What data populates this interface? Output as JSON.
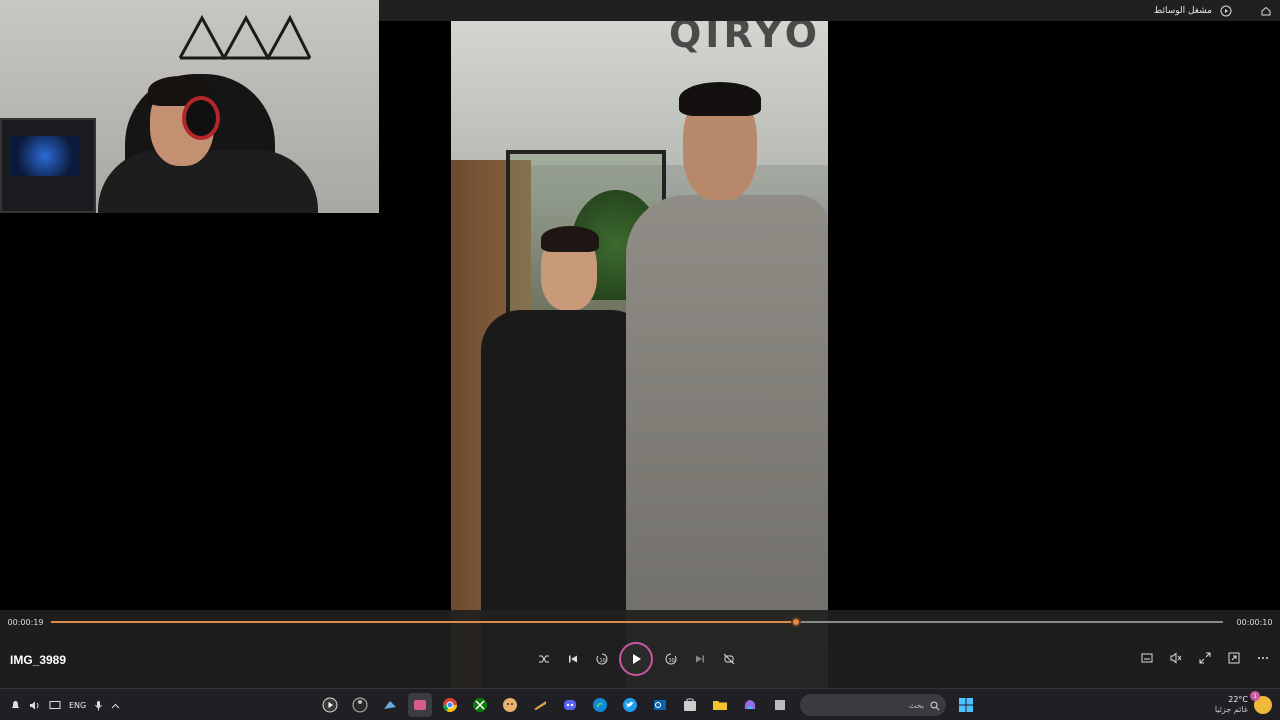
{
  "titlebar": {
    "app_title": "مشغل الوسائط",
    "app_icon": "play-circle-icon",
    "home_icon": "home-icon"
  },
  "video": {
    "sign_text": "QIRYO"
  },
  "player": {
    "current_time": "00:00:19",
    "remaining_time": "00:00:10",
    "progress": 0.636,
    "file_name": "IMG_3989",
    "accent_color": "#e08a4a",
    "play_ring_color": "#c9579f",
    "transport": [
      "shuffle-icon",
      "previous-icon",
      "rewind-10-icon",
      "play-icon",
      "forward-30-icon",
      "next-icon",
      "repeat-off-icon"
    ],
    "tools": [
      "captions-icon",
      "volume-mute-icon",
      "fullscreen-icon",
      "mini-player-icon",
      "more-icon"
    ]
  },
  "taskbar": {
    "lang": "ENG",
    "search_placeholder": "بحث",
    "temperature": "22°C",
    "condition": "غائم جزئيا",
    "notification_count": "1",
    "apps": [
      "media-player-app",
      "obs-app",
      "steam-app",
      "media-player-active-app",
      "chrome-app",
      "xbox-app",
      "character-app",
      "folder-pen-app",
      "discord-app",
      "edge-app",
      "twitter-app",
      "outlook-app",
      "store-app",
      "file-explorer-app",
      "copilot-app",
      "task-view-app"
    ],
    "start_icon": "windows-start-icon"
  }
}
